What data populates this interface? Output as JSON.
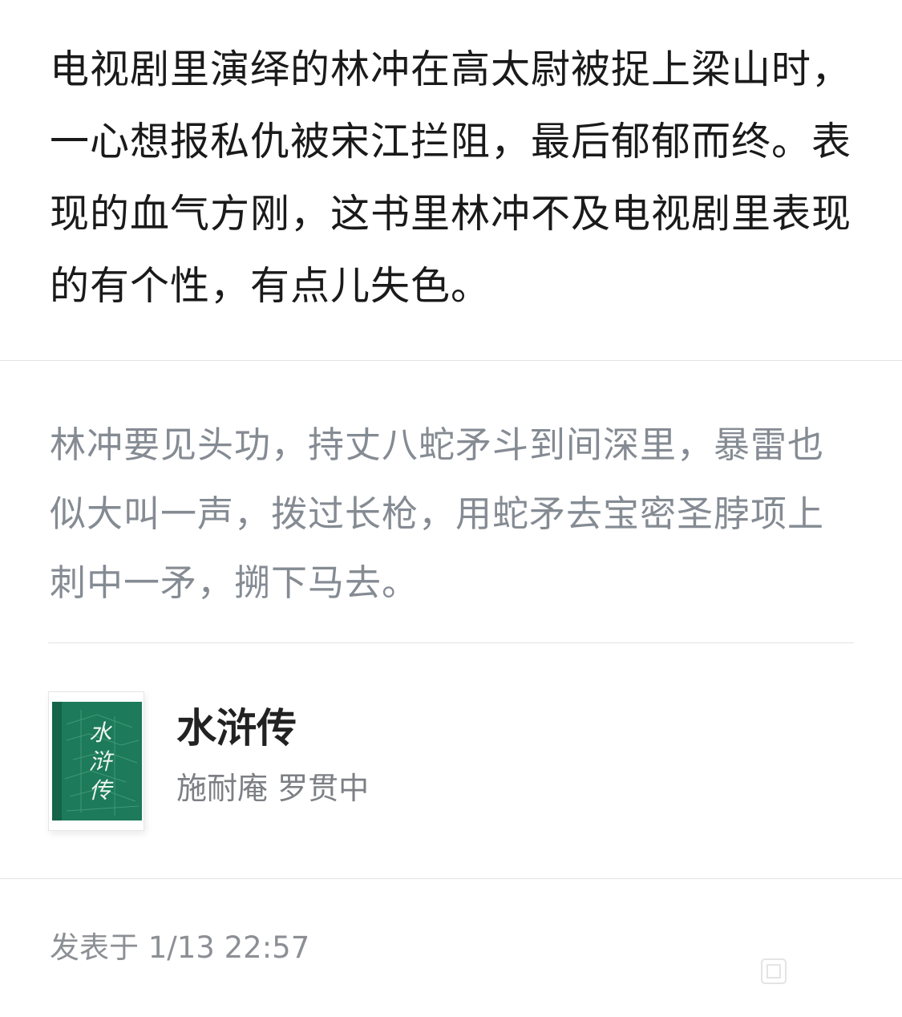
{
  "review": {
    "comment": "电视剧里演绎的林冲在高太尉被捉上梁山时，一心想报私仇被宋江拦阻，最后郁郁而终。表现的血气方刚，这书里林冲不及电视剧里表现的有个性，有点儿失色。",
    "quote": "林冲要见头功，持丈八蛇矛斗到间深里，暴雷也似大叫一声，拨过长枪，用蛇矛去宝密圣脖项上刺中一矛，搠下马去。",
    "post_time": "发表于 1/13 22:57"
  },
  "book": {
    "title": "水浒传",
    "author": "施耐庵 罗贯中",
    "cover_title": "水浒传",
    "cover_color": "#1d7a5a",
    "cover_icon": "book-cover-icon"
  },
  "colors": {
    "comment_text": "#1a1a1a",
    "quote_text": "#858b93",
    "divider": "#e3e3e3",
    "meta_text": "#8c8f94"
  }
}
